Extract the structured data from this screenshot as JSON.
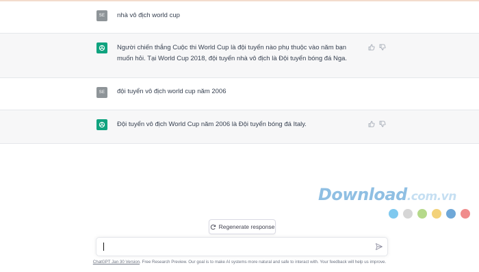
{
  "conversation": [
    {
      "role": "user",
      "avatar_label": "SE",
      "text": "nhà vô địch world cup"
    },
    {
      "role": "assistant",
      "avatar_icon": "openai-logo-icon",
      "text": "Người chiến thắng Cuộc thi World Cup là đội tuyển nào phụ thuộc vào năm bạn muốn hỏi. Tại World Cup 2018, đội tuyển nhà vô địch là Đội tuyển bóng đá Nga."
    },
    {
      "role": "user",
      "avatar_label": "SE",
      "text": "đội tuyển vô địch world cup năm 2006"
    },
    {
      "role": "assistant",
      "avatar_icon": "openai-logo-icon",
      "text": "Đội tuyển vô địch World Cup năm 2006 là Đội tuyển bóng đá Italy."
    }
  ],
  "actions": {
    "regenerate_label": "Regenerate response"
  },
  "composer": {
    "value": "",
    "placeholder": ""
  },
  "footer": {
    "version_link": "ChatGPT Jan 30 Version",
    "text": ". Free Research Preview. Our goal is to make AI systems more natural and safe to interact with. Your feedback will help us improve."
  },
  "watermark": {
    "brand": "Download",
    "domain": ".com.vn",
    "dot_colors": [
      "#7fc9ef",
      "#d6d6d6",
      "#b5d98a",
      "#f3d27a",
      "#6fa8d8",
      "#f08c8c"
    ]
  },
  "colors": {
    "accent": "#10a37f",
    "user_avatar": "#8e9498",
    "assistant_bg": "#f7f7f8"
  }
}
